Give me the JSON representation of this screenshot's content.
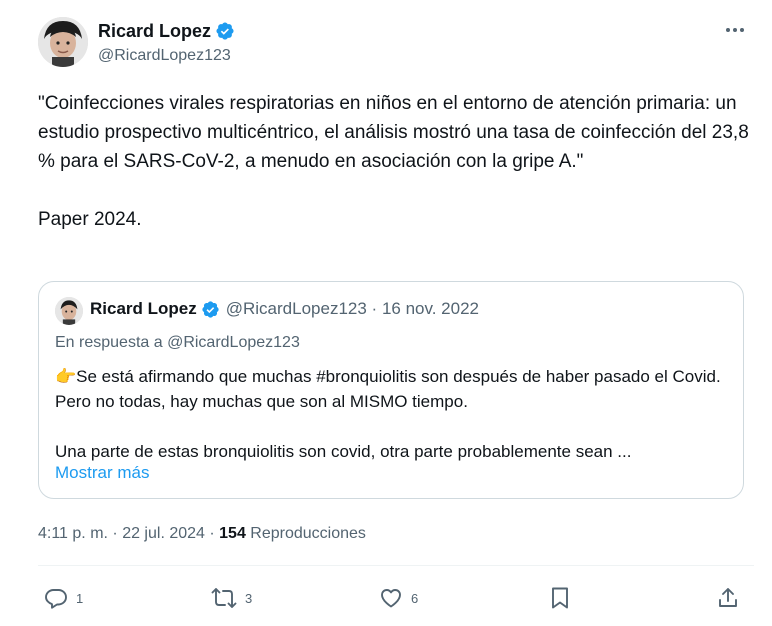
{
  "author": {
    "name": "Ricard Lopez",
    "handle": "@RicardLopez123"
  },
  "tweet": {
    "text": "\"Coinfecciones virales respiratorias en niños en el entorno de atención primaria: un estudio prospectivo multicéntrico, el análisis mostró una tasa de coinfección del 23,8 % para el SARS-CoV-2, a menudo en asociación con la gripe A.\"\n\nPaper 2024."
  },
  "quote": {
    "name": "Ricard Lopez",
    "handle": "@RicardLopez123",
    "separator": " · ",
    "date": "16 nov. 2022",
    "reply_to": "En respuesta a @RicardLopez123",
    "text": "👉Se está afirmando que muchas #bronquiolitis son después de haber pasado el Covid. Pero no todas, hay muchas que son al MISMO tiempo.\n\nUna parte de estas bronquiolitis son covid, otra parte probablemente sean ...",
    "show_more": "Mostrar más"
  },
  "meta": {
    "time": "4:11 p. m.",
    "separator": " · ",
    "date": "22 jul. 2024",
    "views_count": "154",
    "views_label": "Reproducciones"
  },
  "actions": {
    "replies": "1",
    "reposts": "3",
    "likes": "6"
  },
  "colors": {
    "accent": "#1d9bf0",
    "secondary_text": "#536471",
    "border": "#cfd9de"
  },
  "icons": [
    "verified-badge-icon",
    "more-options-icon",
    "reply-icon",
    "repost-icon",
    "like-icon",
    "bookmark-icon",
    "share-icon"
  ]
}
